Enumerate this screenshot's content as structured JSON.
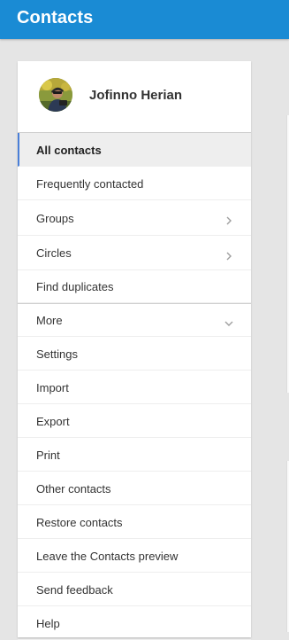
{
  "app": {
    "title": "Contacts"
  },
  "profile": {
    "name": "Jofinno Herian"
  },
  "menu": {
    "primary": [
      {
        "label": "All contacts",
        "active": true
      },
      {
        "label": "Frequently contacted"
      },
      {
        "label": "Groups",
        "chevron": "chevron-right-icon"
      },
      {
        "label": "Circles",
        "chevron": "chevron-right-icon"
      },
      {
        "label": "Find duplicates"
      }
    ],
    "secondary": [
      {
        "label": "More",
        "chevron": "chevron-down-icon"
      },
      {
        "label": "Settings"
      },
      {
        "label": "Import"
      },
      {
        "label": "Export"
      },
      {
        "label": "Print"
      },
      {
        "label": "Other contacts"
      },
      {
        "label": "Restore contacts"
      },
      {
        "label": "Leave the Contacts preview"
      },
      {
        "label": "Send feedback"
      },
      {
        "label": "Help"
      }
    ]
  },
  "colors": {
    "app_bar": "#1a8bd4",
    "active_indicator": "#4a7fd8"
  }
}
